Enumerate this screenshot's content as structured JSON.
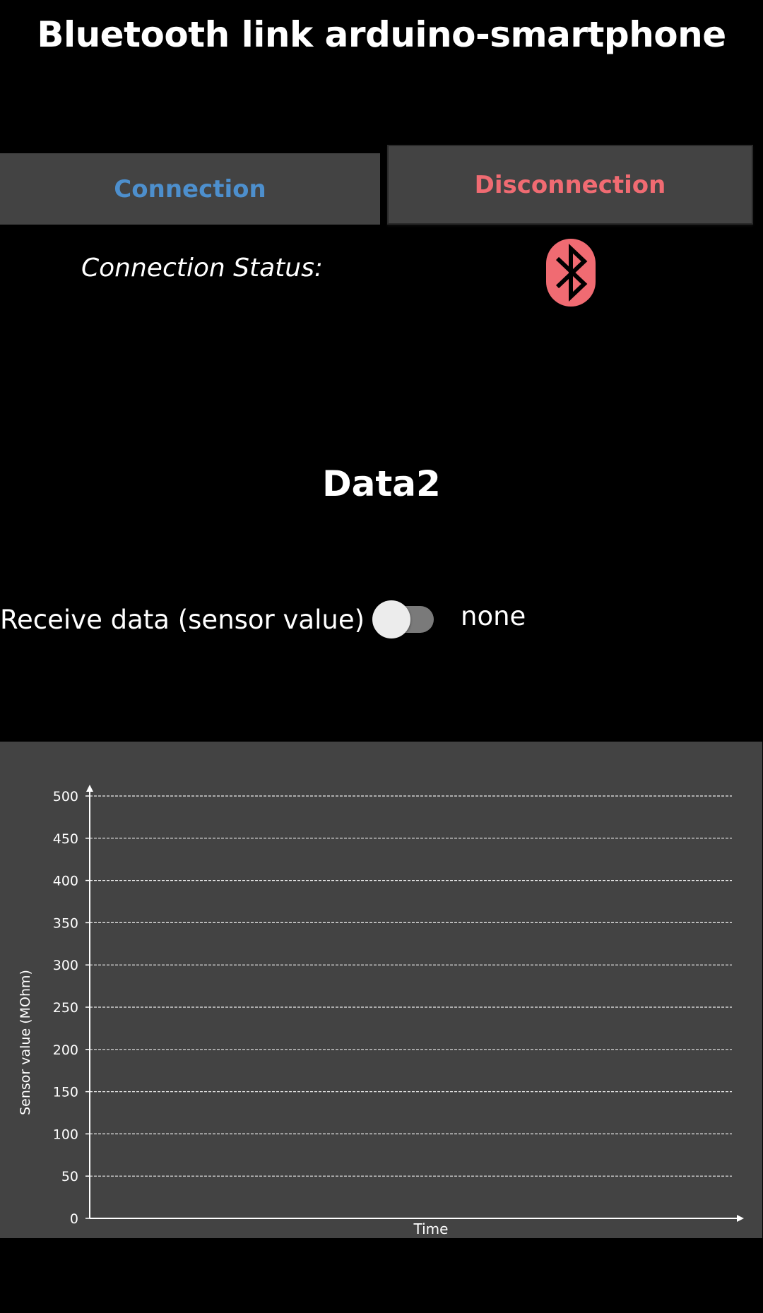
{
  "header": {
    "title": "Bluetooth link arduino-smartphone"
  },
  "buttons": {
    "connection_label": "Connection",
    "disconnection_label": "Disconnection"
  },
  "status": {
    "label": "Connection Status:",
    "icon": "bluetooth-icon",
    "badge_color": "#f06b72"
  },
  "data_section": {
    "title": "Data2",
    "receive_label": "Receive data (sensor value)",
    "toggle_on": false,
    "value": "none"
  },
  "colors": {
    "background": "#000000",
    "panel": "#434343",
    "connection_text": "#4d8fcd",
    "disconnection_text": "#f06b72",
    "chart_lines": "#ffffff"
  },
  "chart_data": {
    "type": "line",
    "series": [],
    "xlabel": "Time",
    "ylabel": "Sensor value (MOhm)",
    "ylim": [
      0,
      500
    ],
    "yticks": [
      0,
      50,
      100,
      150,
      200,
      250,
      300,
      350,
      400,
      450,
      500
    ],
    "grid": true
  }
}
